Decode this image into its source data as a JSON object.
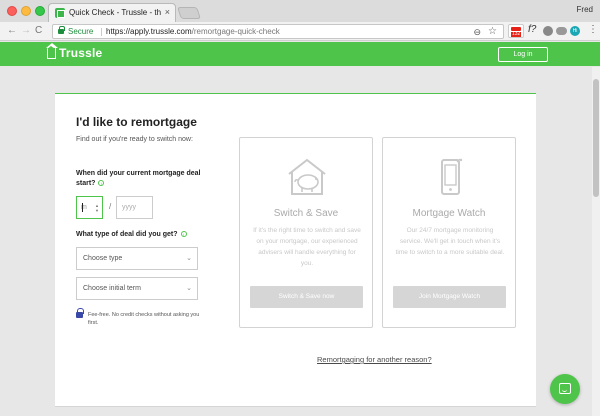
{
  "browser": {
    "tab_title": "Quick Check - Trussle - the s…",
    "tab_close": "×",
    "profile_name": "Fred",
    "secure_label": "Secure",
    "url_host": "https://apply.trussle.com",
    "url_path": "/remortgage-quick-check",
    "nav_back": "←",
    "nav_forward": "→",
    "nav_reload": "C",
    "zoom_icon": "⊖",
    "star_icon": "☆",
    "ext_badge": "132",
    "ext_f": "f?",
    "ext_hi": "Hi",
    "menu_icon": "⋮"
  },
  "header": {
    "logo_text": "Trussle",
    "login_label": "Log in",
    "brand_color": "#4ec54a"
  },
  "form": {
    "title": "I'd like to remortgage",
    "subtitle": "Find out if you're ready to switch now:",
    "question_start": "When did your current mortgage deal start?",
    "info_icon": "i",
    "month_placeholder": "m",
    "spin_up": "▲",
    "spin_down": "▼",
    "date_separator": "/",
    "year_placeholder": "yyyy",
    "question_type": "What type of deal did you get?",
    "select_type": "Choose type",
    "select_term": "Choose initial term",
    "chevron": "⌄",
    "fee_notice": "Fee-free. No credit checks without asking you first."
  },
  "options": [
    {
      "title": "Switch & Save",
      "description": "If it's the right time to switch and save on your mortgage, our experienced advisers will handle everything for you.",
      "button": "Switch & Save now"
    },
    {
      "title": "Mortgage Watch",
      "description": "Our 24/7 mortgage monitoring service. We'll get in touch when it's time to switch to a more suitable deal.",
      "button": "Join Mortgage Watch"
    }
  ],
  "other_link": "Remortgaging for another reason?"
}
